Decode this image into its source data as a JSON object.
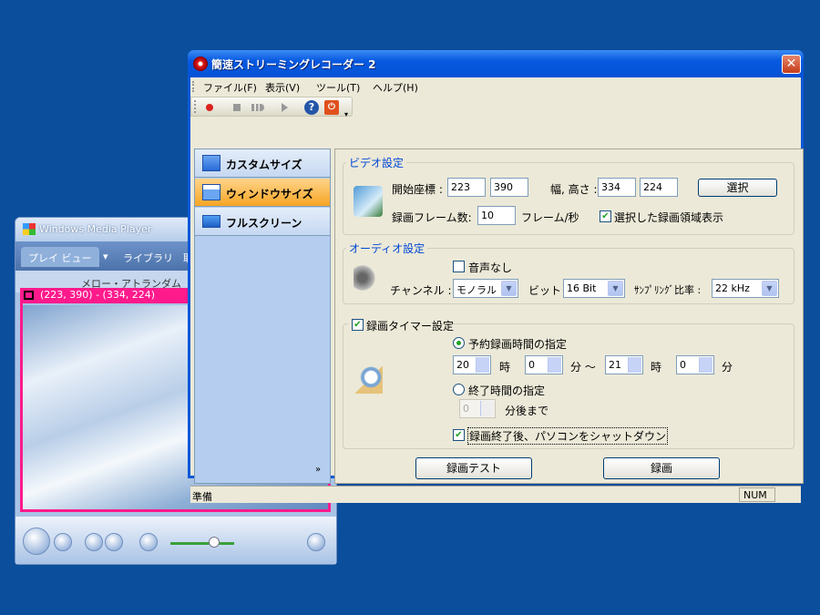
{
  "wmp": {
    "title": "Windows Media Player",
    "tabs": [
      "プレイ ビュー",
      "▾",
      "ライブラリ",
      "取"
    ],
    "now_playing": "メロー・アトランダム"
  },
  "selection": {
    "coords": "(223, 390) - (334, 224)"
  },
  "app": {
    "title": "簡速ストリーミングレコーダー 2",
    "close": "✕",
    "menu": [
      "ファイル(F)",
      "表示(V)",
      "ツール(T)",
      "ヘルプ(H)"
    ],
    "nav": [
      {
        "label": "カスタムサイズ",
        "selected": false
      },
      {
        "label": "ウィンドウサイズ",
        "selected": true
      },
      {
        "label": "フルスクリーン",
        "selected": false
      }
    ],
    "nav_more": "»",
    "video": {
      "group": "ビデオ設定",
      "start_label": "開始座標 :",
      "start_x": "223",
      "start_y": "390",
      "size_label": "幅, 高さ :",
      "width": "334",
      "height": "224",
      "select_button": "選択",
      "frames_label": "録画フレーム数:",
      "frames": "10",
      "frames_unit": "フレーム/秒",
      "show_area_label": "選択した録画領域表示",
      "show_area_checked": true
    },
    "audio": {
      "group": "オーディオ設定",
      "mute_label": "音声なし",
      "mute_checked": false,
      "channel_label": "チャンネル :",
      "channel": "モノラル",
      "bit_label": "ビット :",
      "bit": "16 Bit",
      "rate_label": "ｻﾝﾌﾟﾘﾝｸﾞ比率 :",
      "rate": "22 kHz"
    },
    "timer": {
      "group": "録画タイマー設定",
      "checked": true,
      "scheduled_label": "予約録画時間の指定",
      "h1": "20",
      "hour_unit": "時",
      "m1": "0",
      "min_tilde": "分 〜",
      "h2": "21",
      "hour_unit2": "時",
      "m2": "0",
      "min_unit": "分",
      "end_label": "終了時間の指定",
      "after": "0",
      "after_unit": "分後まで",
      "shutdown_label": "録画終了後、パソコンをシャットダウン",
      "shutdown_checked": true
    },
    "test_button": "録画テスト",
    "record_button": "録画",
    "status": "準備",
    "num": "NUM"
  }
}
